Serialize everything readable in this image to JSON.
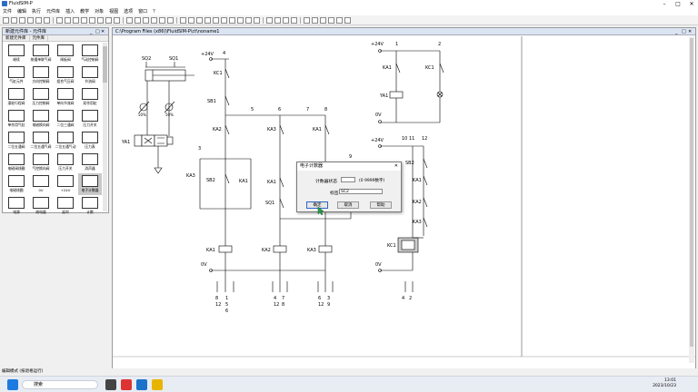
{
  "app": {
    "title": "FluidSIM-P"
  },
  "menu": [
    "文件",
    "编辑",
    "执行",
    "元件库",
    "插入",
    "教学",
    "对象",
    "视图",
    "选项",
    "窗口",
    "？"
  ],
  "library": {
    "title": "新建元件库 - 元件库",
    "tabs": [
      "新建元件库",
      "元件库"
    ],
    "items": [
      "继续",
      "按通单联气阀",
      "闸板阀",
      "气动控制阀",
      "气缸元件",
      "方向控制阀",
      "组合气压阀",
      "节流阀",
      "滚轮行程阀",
      "压力控制阀",
      "单向节流阀",
      "双作用缸",
      "单作用气缸",
      "电磁换向阀",
      "二位三通阀",
      "压力开关",
      "二位五通阀",
      "二位五通气阀",
      "二位五通气动",
      "压力表",
      "电磁阀线圈",
      "气控换向阀",
      "压力开关",
      "消声器",
      "电磁线圈",
      "0V",
      "+24V",
      "电子计数器",
      "电源",
      "继电器",
      "延时",
      "计数"
    ]
  },
  "diagram": {
    "title": "C:\\Program Files (x86)\\FluidSIM-P\\ct\\noname1",
    "labels": {
      "plus24": "+24V",
      "zeroV": "0V",
      "kc1": "KC1",
      "sb1": "SB1",
      "ka1": "KA1",
      "ka2": "KA2",
      "ka3": "KA3",
      "sb2": "SB2",
      "sq1": "SQ1",
      "sq2": "SQ2",
      "ya1": "YA1",
      "n1": "1",
      "n2": "2",
      "n3": "3",
      "n4": "4",
      "n5": "5",
      "n6": "6",
      "n7": "7",
      "n8": "8",
      "n9": "9",
      "n10": "10",
      "n11": "11",
      "n12": "12",
      "s_a": "8",
      "s_b": "12",
      "s_c": "1",
      "s_d": "5",
      "s_e": "6",
      "s_f": "4",
      "s_g": "7",
      "s_h": "12",
      "s_i": "8",
      "s_j": "6",
      "s_k": "3",
      "s_l": "12",
      "s_m": "9",
      "s_n": "4",
      "s_o": "2"
    }
  },
  "dialog": {
    "title": "电子计数器",
    "counter_label": "计数器状态",
    "counter_value": "",
    "range_text": "(0 9999数字)",
    "tag_label": "标签",
    "tag_value": "SC2",
    "ok": "确定",
    "cancel": "取消",
    "help": "帮助"
  },
  "status": {
    "text": "编辑模式 (按退格运行)"
  },
  "taskbar": {
    "search_placeholder": "搜索",
    "time": "13:01",
    "date": "2023/10/23"
  }
}
